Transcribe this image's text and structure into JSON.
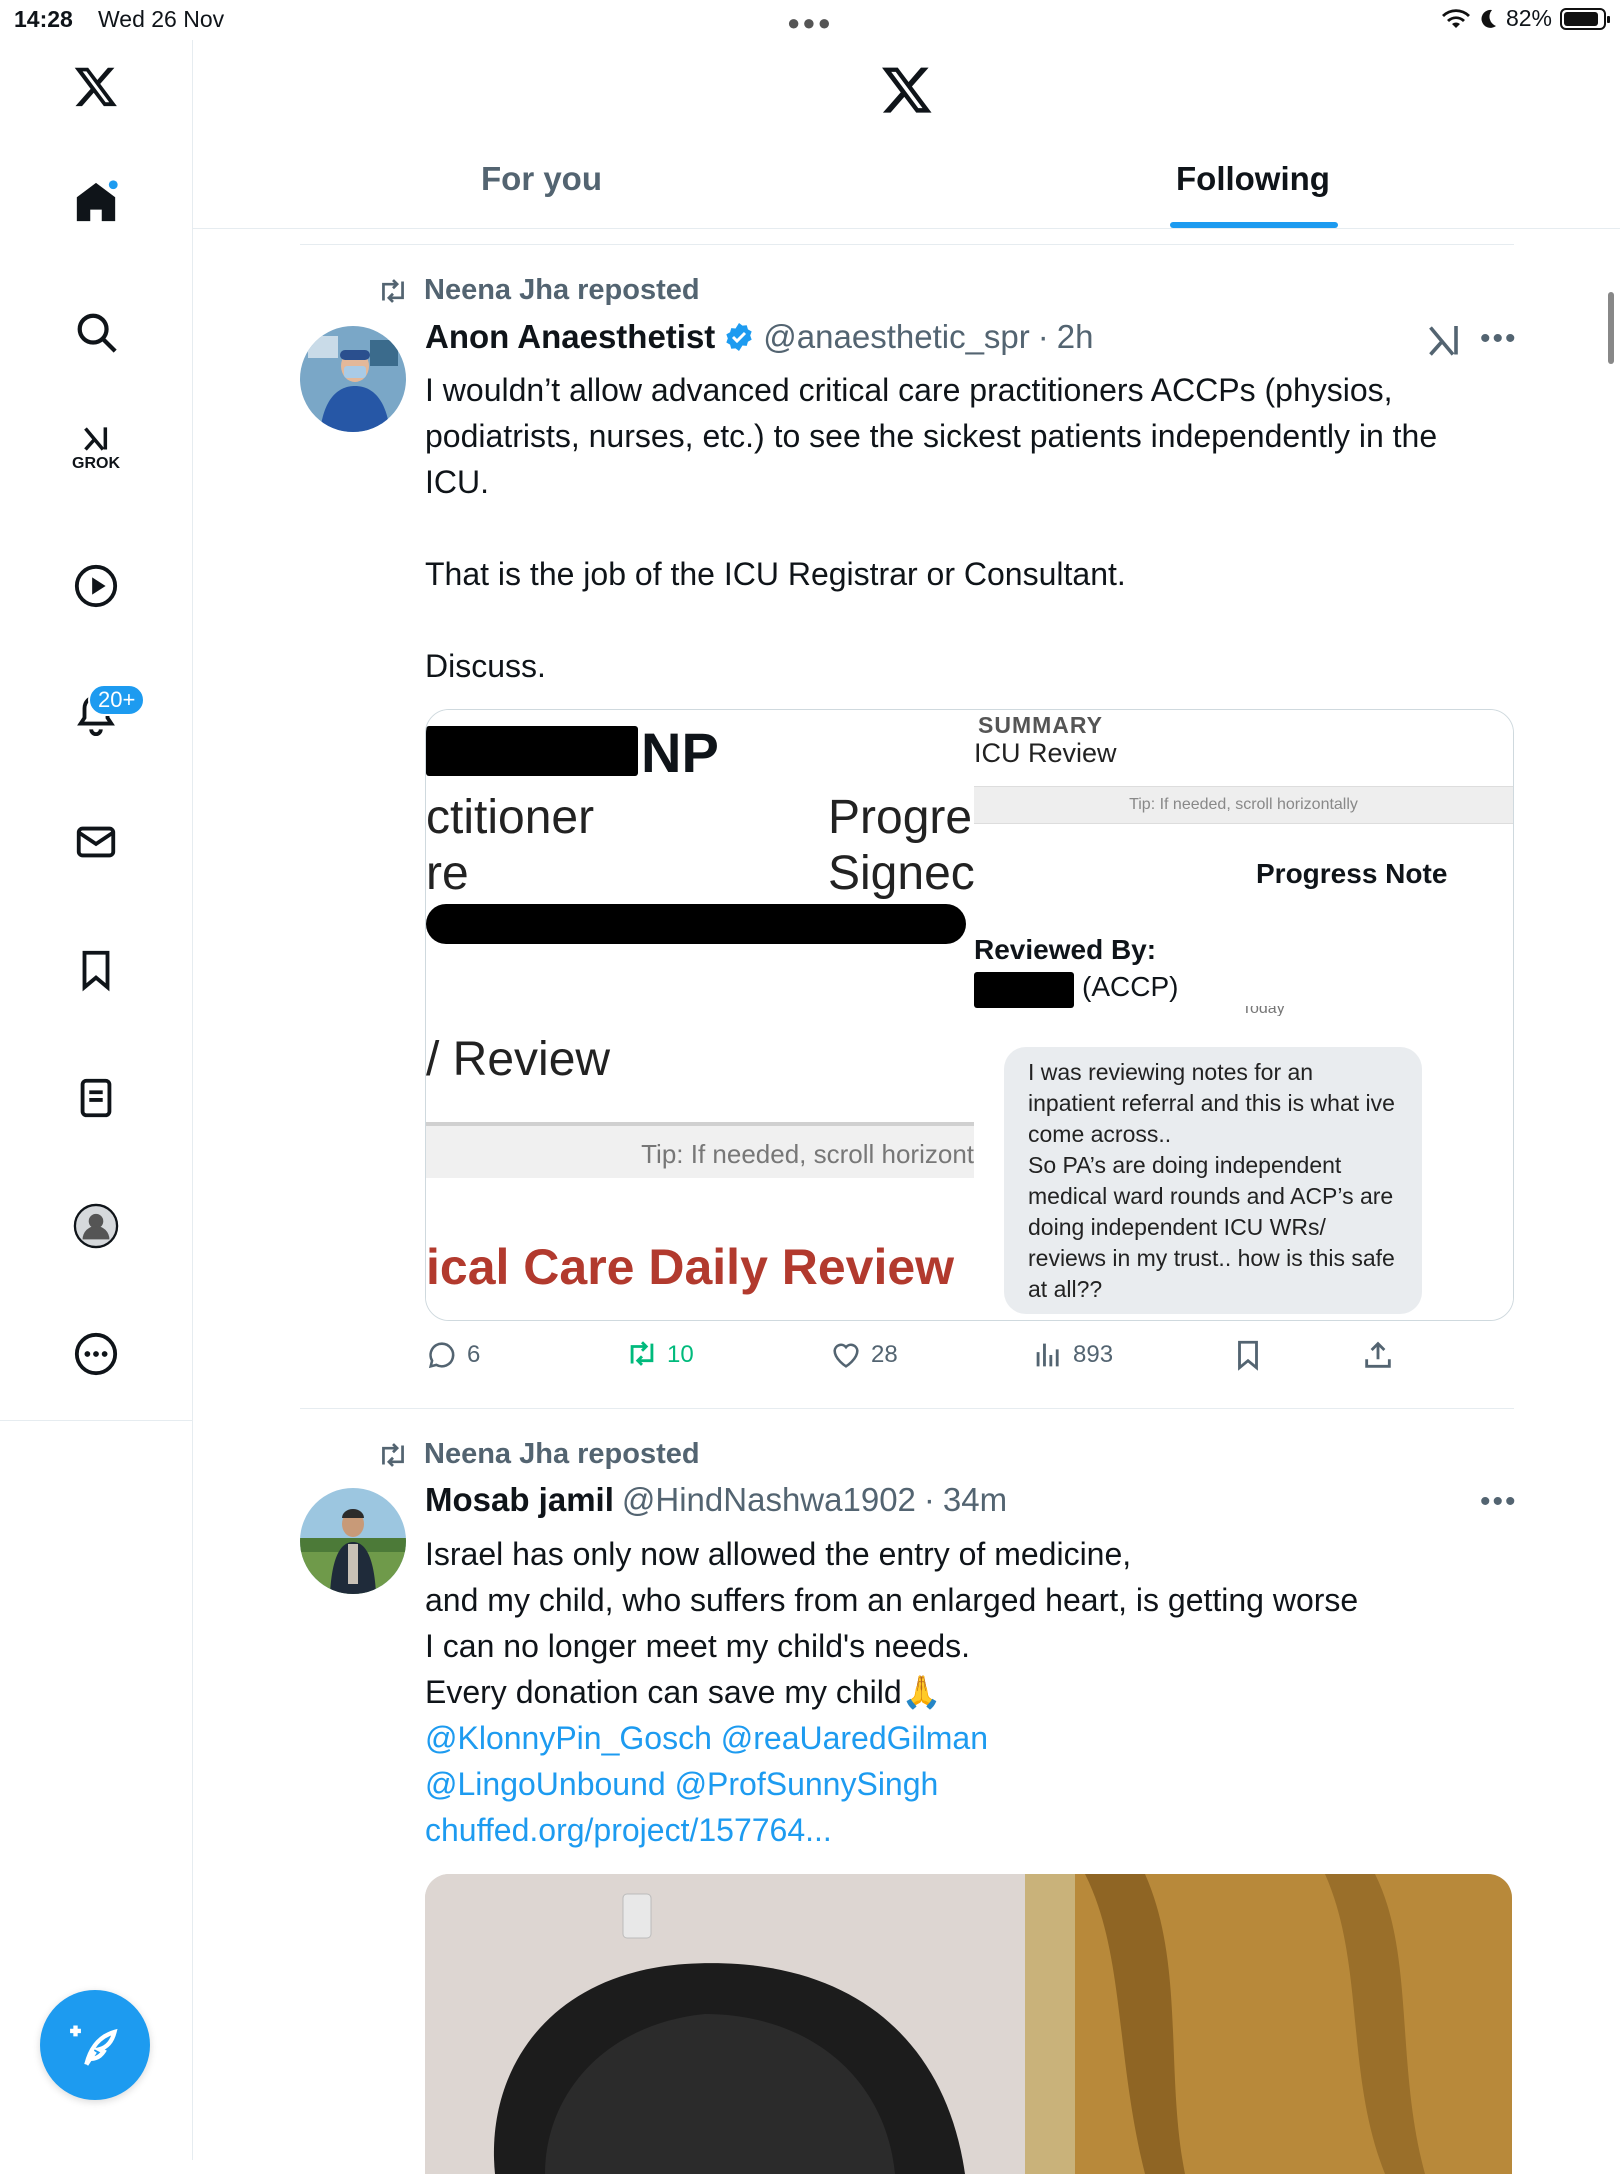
{
  "status_bar": {
    "time": "14:28",
    "date": "Wed 26 Nov",
    "battery": "82%"
  },
  "sidebar": {
    "grok_label": "GROK",
    "notifications_badge": "20+"
  },
  "tabs": [
    {
      "label": "For you",
      "selected": false
    },
    {
      "label": "Following",
      "selected": true
    }
  ],
  "posts": [
    {
      "repost_by": "Neena Jha reposted",
      "name": "Anon Anaesthetist",
      "handle": "@anaesthetic_spr",
      "time": "2h",
      "verified": true,
      "text": "I wouldn’t allow advanced critical care practitioners ACCPs (physios, podiatrists, nurses, etc.) to see the sickest patients independently in the ICU.\n\nThat is the job of the ICU Registrar or Consultant.\n\nDiscuss.",
      "media": {
        "left": {
          "np": "NP",
          "line1": "ctitioner",
          "line2": "re",
          "progress": "Progre",
          "signed": "Signec",
          "review": "/ Review",
          "tip": "Tip: If needed, scroll horizont",
          "red_title": "ical Care Daily Review"
        },
        "right": {
          "summary": "SUMMARY",
          "icu_review": "ICU Review",
          "tip": "Tip: If needed, scroll horizontally",
          "progress_note": "Progress Note",
          "reviewed_by": "Reviewed By:",
          "accp": "(ACCP)",
          "today": "Today",
          "message": "I was reviewing notes for an inpatient referral and this is what ive come across..\nSo PA’s are doing independent medical ward rounds and ACP’s are doing independent ICU WRs/ reviews in my trust.. how is this safe at all??"
        }
      },
      "stats": {
        "replies": "6",
        "reposts": "10",
        "likes": "28",
        "views": "893"
      }
    },
    {
      "repost_by": "Neena Jha reposted",
      "name": "Mosab jamil",
      "handle": "@HindNashwa1902",
      "time": "34m",
      "text_lines": [
        "Israel has only now allowed the entry of medicine,",
        "and my child, who suffers from an enlarged heart, is getting worse",
        "I can no longer meet my child's needs.",
        "Every donation can save my child🙏"
      ],
      "links": [
        "@KlonnyPin_Gosch @reaUaredGilman",
        "@LingoUnbound @ProfSunnySingh",
        "chuffed.org/project/157764..."
      ]
    }
  ],
  "colors": {
    "accent": "#1d9bf0",
    "repost_green": "#00ba7c",
    "muted": "#536471",
    "redacted_title": "#b23a2e"
  },
  "icons": [
    "x-logo-icon",
    "home-icon",
    "search-icon",
    "grok-icon",
    "video-icon",
    "bell-icon",
    "mail-icon",
    "bookmark-icon",
    "lists-icon",
    "profile-icon",
    "more-icon",
    "compose-icon",
    "repost-icon",
    "verified-icon",
    "reply-icon",
    "like-icon",
    "views-icon",
    "share-icon"
  ]
}
